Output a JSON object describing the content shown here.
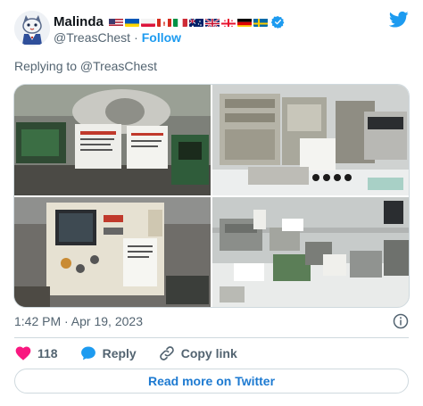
{
  "author": {
    "name": "Malinda",
    "handle": "@TreasChest",
    "follow_label": "Follow",
    "flags": [
      "us-flag",
      "ua-flag",
      "pl-flag",
      "ca-flag",
      "it-flag",
      "au-flag",
      "gb-flag",
      "ge-flag",
      "de-flag",
      "se-flag"
    ],
    "verified_icon": "verified-badge-icon",
    "avatar_icon": "avatar-cat-icon"
  },
  "platform": {
    "logo_icon": "twitter-bird-icon",
    "accent": "#1d9bf0"
  },
  "replying_to": "Replying to @TreasChest",
  "media": {
    "images": [
      {
        "name": "photo-top-left",
        "description_icon": "equipment-photo"
      },
      {
        "name": "photo-top-right",
        "description_icon": "equipment-photo"
      },
      {
        "name": "photo-bottom-left",
        "description_icon": "equipment-photo"
      },
      {
        "name": "photo-bottom-right",
        "description_icon": "equipment-photo"
      }
    ]
  },
  "timestamp": "1:42 PM · Apr 19, 2023",
  "info_icon": "info-icon",
  "actions": {
    "like": {
      "icon": "heart-icon",
      "count": "118",
      "color": "#f91880"
    },
    "reply": {
      "icon": "reply-bubble-icon",
      "label": "Reply"
    },
    "copy_link": {
      "icon": "link-icon",
      "label": "Copy link"
    }
  },
  "read_more_label": "Read more on Twitter"
}
